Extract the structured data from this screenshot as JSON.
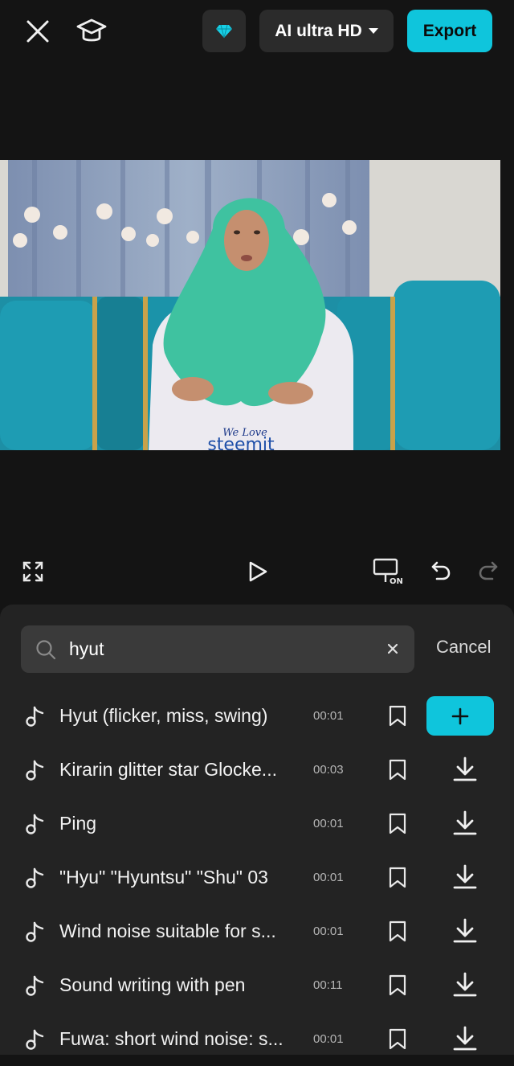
{
  "header": {
    "quality_label": "AI ultra HD",
    "export_label": "Export",
    "accent_color": "#0fc5dc"
  },
  "video": {
    "shirt_text_line1": "We Love",
    "shirt_text_line2": "steemit"
  },
  "search": {
    "query": "hyut",
    "cancel_label": "Cancel"
  },
  "results": [
    {
      "title": "Hyut (flicker, miss, swing)",
      "duration": "00:01",
      "action": "add"
    },
    {
      "title": "Kirarin glitter star Glocke...",
      "duration": "00:03",
      "action": "download"
    },
    {
      "title": "Ping",
      "duration": "00:01",
      "action": "download"
    },
    {
      "title": "\"Hyu\" \"Hyuntsu\" \"Shu\" 03",
      "duration": "00:01",
      "action": "download"
    },
    {
      "title": "Wind noise suitable for s...",
      "duration": "00:01",
      "action": "download"
    },
    {
      "title": "Sound writing with pen",
      "duration": "00:11",
      "action": "download"
    },
    {
      "title": "Fuwa: short wind noise: s...",
      "duration": "00:01",
      "action": "download"
    }
  ]
}
